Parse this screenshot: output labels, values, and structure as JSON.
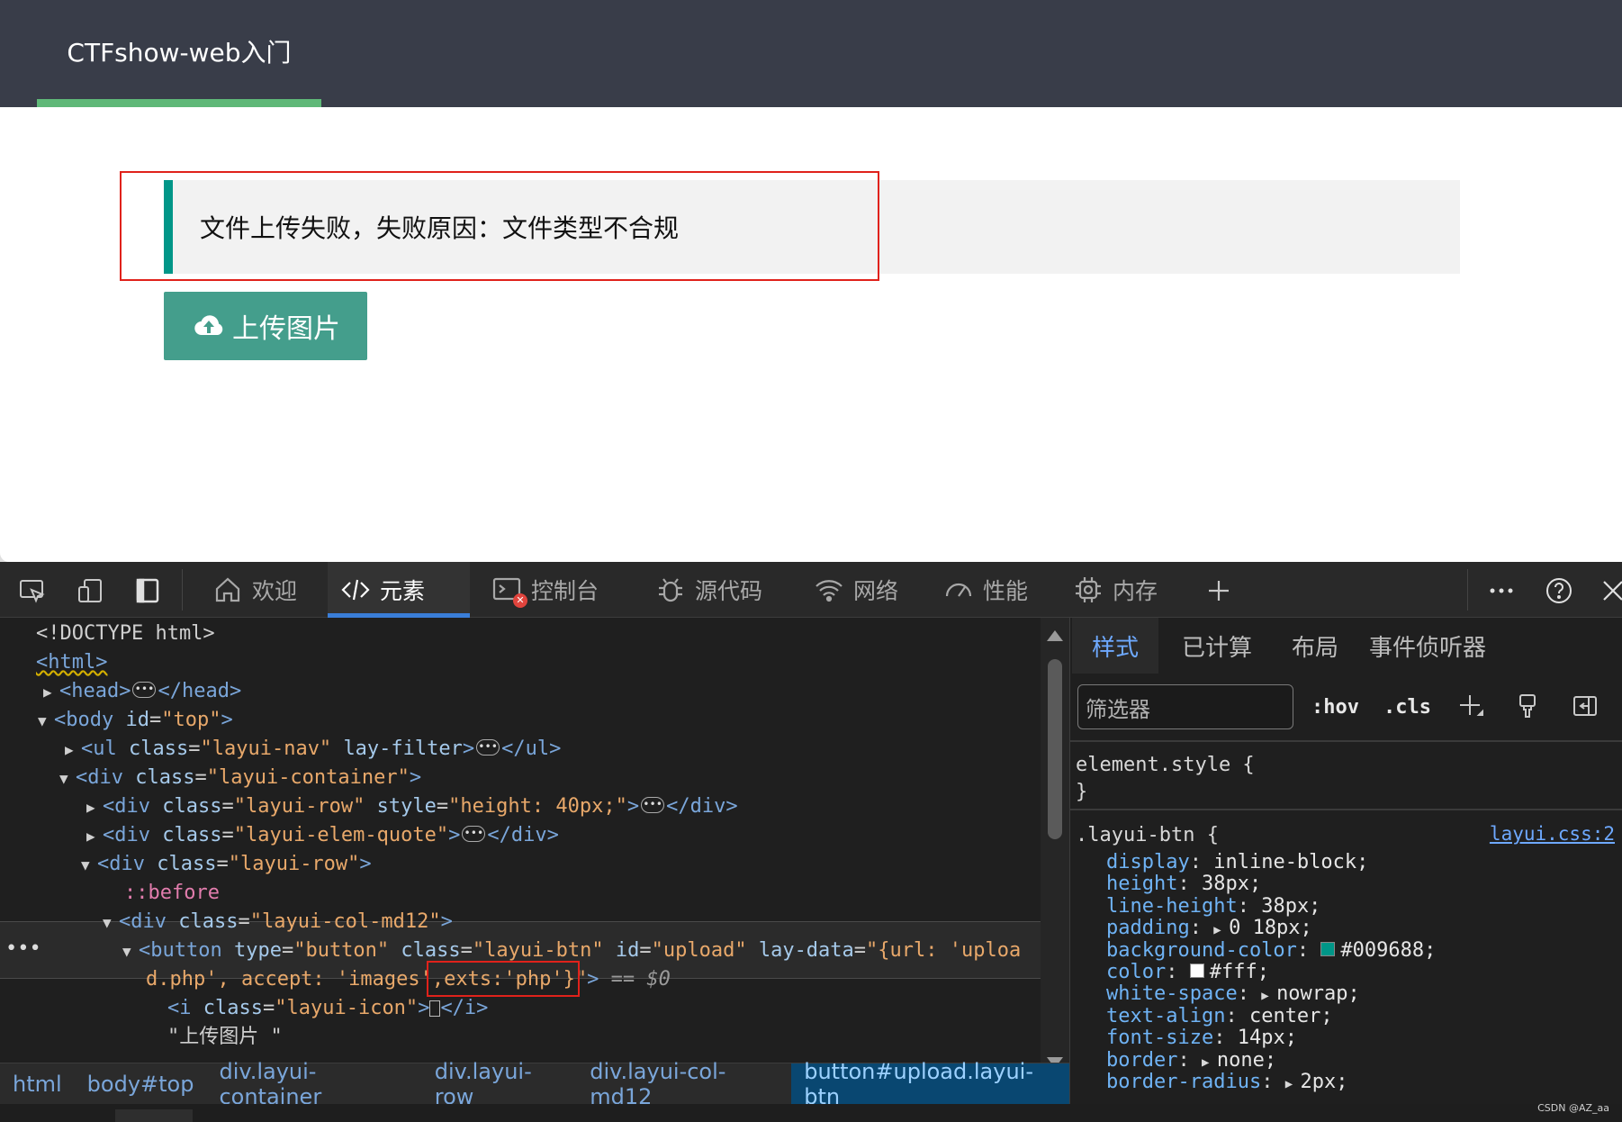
{
  "page": {
    "nav_title": "CTFshow-web入门",
    "quote_text": "文件上传失败，失败原因：文件类型不合规",
    "upload_label": "上传图片"
  },
  "devtools": {
    "tabs": [
      "欢迎",
      "元素",
      "控制台",
      "源代码",
      "网络",
      "性能",
      "内存"
    ],
    "active_tab": "元素",
    "dom_lines": {
      "doctype": "<!DOCTYPE html>",
      "head_open": "<head>",
      "head_close": "</head>",
      "body_tag": "body",
      "body_attr": "id",
      "body_val": "\"top\"",
      "ul_attr_class": "\"layui-nav\"",
      "ul_attr2": "lay-filter",
      "container_class": "\"layui-container\"",
      "row_style": "\"height: 40px;\"",
      "quote_class": "\"layui-elem-quote\"",
      "row_class": "\"layui-row\"",
      "before": "::before",
      "col_class": "\"layui-col-md12\"",
      "button_type": "\"button\"",
      "button_class": "\"layui-btn\"",
      "button_id": "\"upload\"",
      "button_laydata_1": "\"{url: 'uploa",
      "button_laydata_2a": "d.php', accept: 'images'",
      "button_laydata_2b": ",exts:'php'}",
      "button_laydata_2c": "\"",
      "dollar0": "== $0",
      "i_class": "\"layui-icon\"",
      "i_content": "",
      "text_node": "\"上传图片 \""
    },
    "breadcrumbs": [
      "html",
      "body#top",
      "div.layui-container",
      "div.layui-row",
      "div.layui-col-md12",
      "button#upload.layui-btn"
    ],
    "styles_tabs": [
      "样式",
      "已计算",
      "布局",
      "事件侦听器"
    ],
    "filter_placeholder": "筛选器",
    "hov": ":hov",
    "cls": ".cls",
    "element_style": "element.style {",
    "close_brace": "}",
    "rule_selector": ".layui-btn {",
    "rule_source": "layui.css:2",
    "declarations": [
      {
        "prop": "display",
        "val": "inline-block;"
      },
      {
        "prop": "height",
        "val": "38px;"
      },
      {
        "prop": "line-height",
        "val": "38px;"
      },
      {
        "prop": "padding",
        "val": "0 18px;",
        "arrow": true
      },
      {
        "prop": "background-color",
        "val": "#009688;",
        "swatch": "#009688"
      },
      {
        "prop": "color",
        "val": "#fff;",
        "swatch": "#ffffff"
      },
      {
        "prop": "white-space",
        "val": "nowrap;",
        "arrow": true
      },
      {
        "prop": "text-align",
        "val": "center;"
      },
      {
        "prop": "font-size",
        "val": "14px;"
      },
      {
        "prop": "border",
        "val": "none;",
        "arrow": true
      },
      {
        "prop": "border-radius",
        "val": "2px;",
        "arrow": true
      }
    ]
  },
  "watermark": "CSDN @AZ_aa",
  "colors": {
    "nav_bg": "#393d49",
    "nav_underline": "#5fb878",
    "btn": "#009688",
    "highlight": "#e0221b"
  }
}
